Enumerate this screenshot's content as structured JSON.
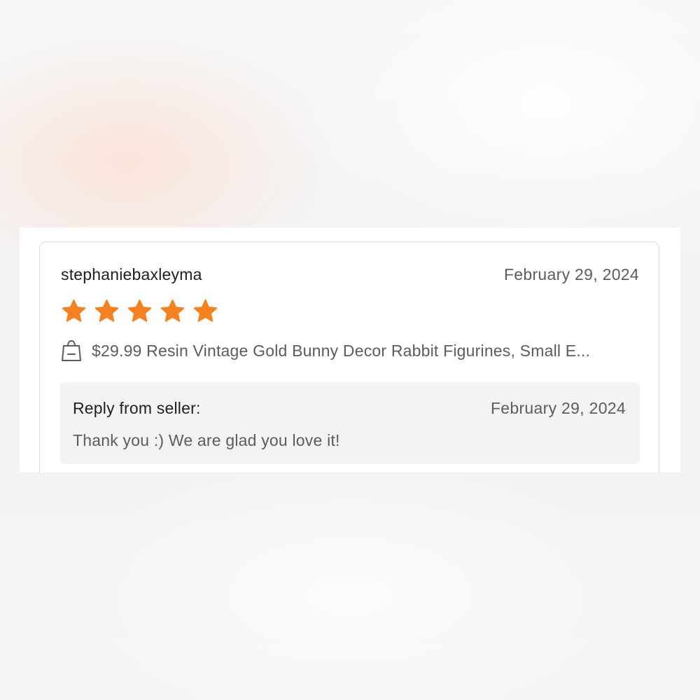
{
  "review": {
    "reviewer_name": "stephaniebaxleyma",
    "date": "February 29, 2024",
    "rating": 5,
    "rating_max": 5,
    "star_color": "#f5821f",
    "product_icon": "shopping-bag-icon",
    "product_title": "$29.99 Resin Vintage Gold Bunny Decor Rabbit Figurines, Small E..."
  },
  "seller_reply": {
    "label": "Reply from seller:",
    "date": "February 29, 2024",
    "text": "Thank you :) We are glad you love it!"
  }
}
